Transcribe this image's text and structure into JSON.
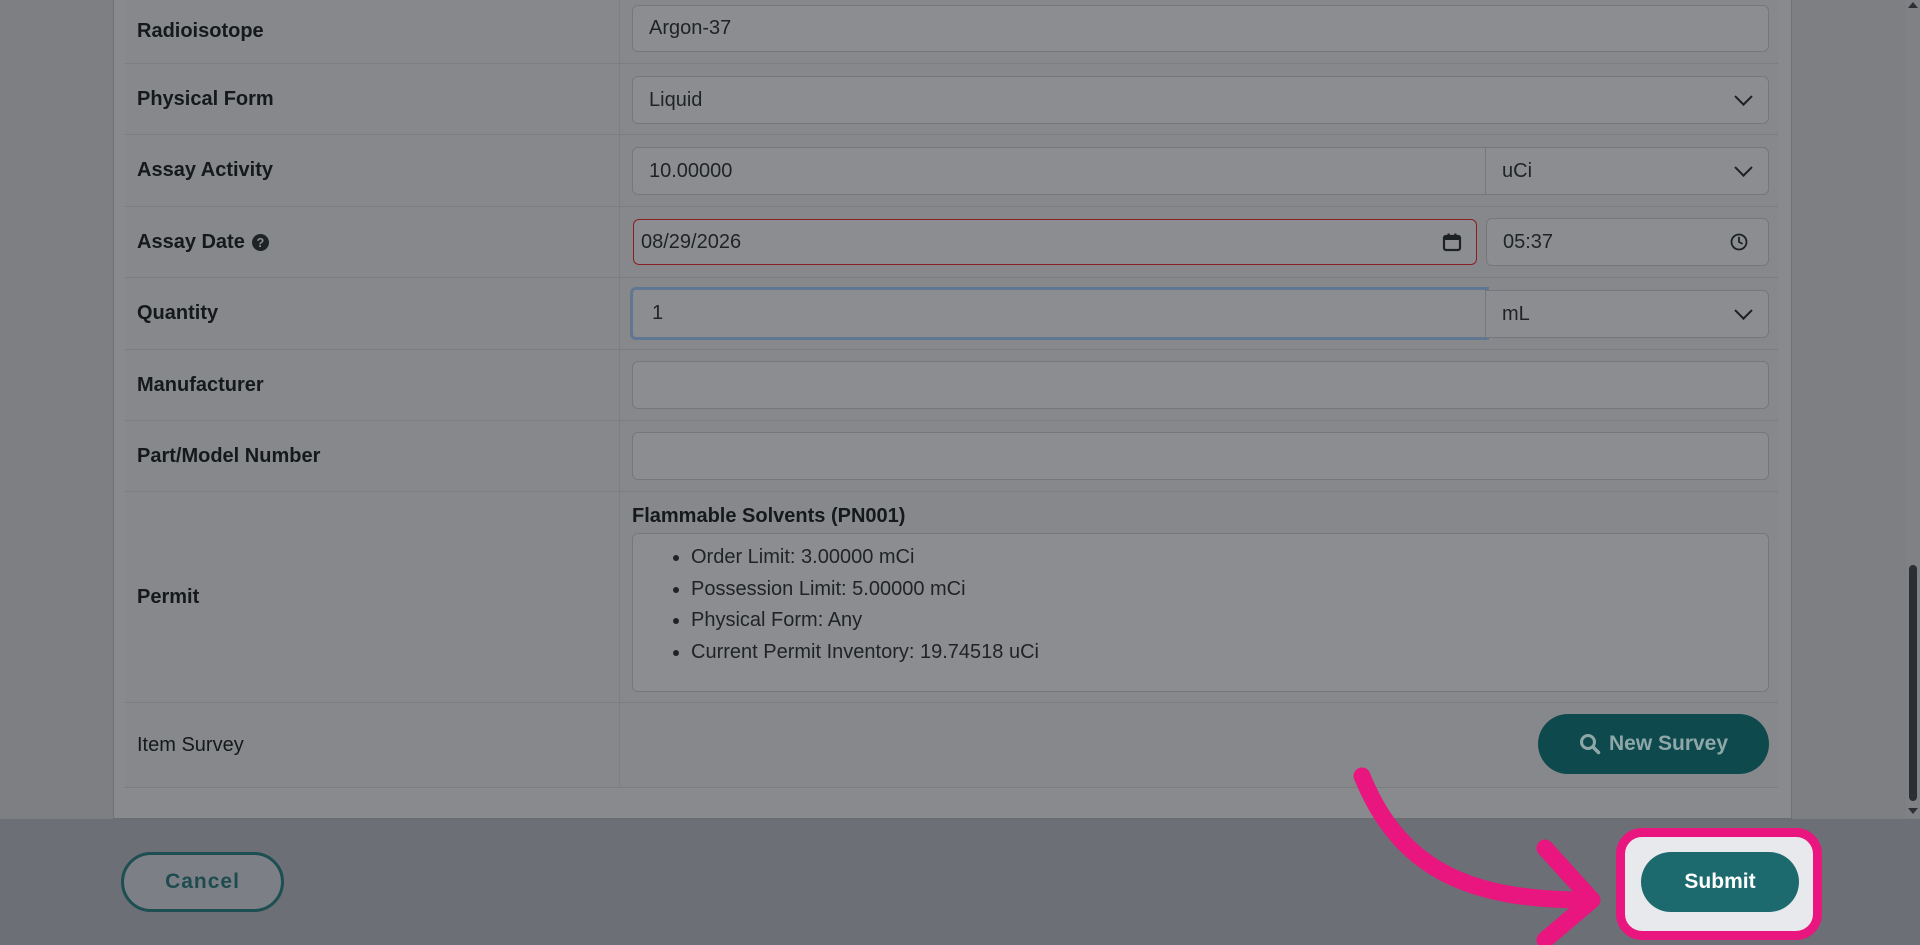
{
  "form": {
    "radioisotope": {
      "label": "Radioisotope",
      "value": "Argon-37"
    },
    "physical_form": {
      "label": "Physical Form",
      "value": "Liquid"
    },
    "assay_activity": {
      "label": "Assay Activity",
      "value": "10.00000",
      "unit": "uCi"
    },
    "assay_date": {
      "label": "Assay Date",
      "date": "08/29/2026",
      "time": "05:37"
    },
    "quantity": {
      "label": "Quantity",
      "value": "1",
      "unit": "mL"
    },
    "manufacturer": {
      "label": "Manufacturer",
      "value": ""
    },
    "part_model_number": {
      "label": "Part/Model Number",
      "value": ""
    },
    "permit": {
      "label": "Permit",
      "title": "Flammable Solvents (PN001)",
      "details": [
        "Order Limit: 3.00000 mCi",
        "Possession Limit: 5.00000 mCi",
        "Physical Form: Any",
        "Current Permit Inventory: 19.74518 uCi"
      ]
    },
    "item_survey": {
      "label": "Item Survey",
      "button": "New Survey"
    }
  },
  "footer": {
    "cancel_label": "Cancel",
    "submit_label": "Submit"
  },
  "colors": {
    "brand_teal": "#1c6a6e",
    "highlight_pink": "#e8167e",
    "error_red": "#8a1f22"
  },
  "icons": [
    "help-icon",
    "chevron-down-icon",
    "calendar-icon",
    "clock-icon",
    "search-icon",
    "arrow-icon"
  ]
}
